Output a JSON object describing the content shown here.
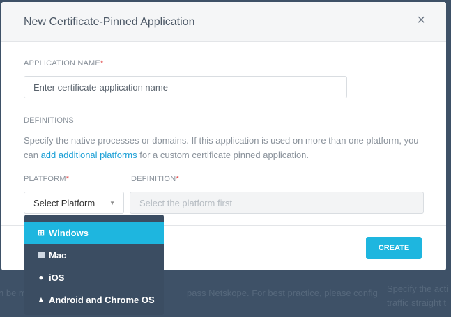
{
  "background": {
    "text_left": "n be m",
    "text_mid": "pass Netskope. For best practice, please config",
    "text_right_1": "Specify the acti",
    "text_right_2": "traffic straight t"
  },
  "modal": {
    "title": "New Certificate-Pinned Application",
    "close_icon": "×",
    "app_name_label": "APPLICATION NAME",
    "required_mark": "*",
    "app_name_placeholder": "Enter certificate-application name",
    "definitions_label": "DEFINITIONS",
    "desc_before": "Specify the native processes or domains. If this application is used on more than one platform, you can ",
    "desc_link": "add additional platforms",
    "desc_after": " for a custom certificate pinned application.",
    "platform_label": "PLATFORM",
    "definition_label": "DEFINITION",
    "platform_value": "Select Platform",
    "definition_placeholder": "Select the platform first",
    "create_label": "CREATE"
  },
  "dropdown": {
    "options": [
      {
        "label": "Windows",
        "icon": "windows-icon",
        "selected": true
      },
      {
        "label": "Mac",
        "icon": "mac-finder-icon"
      },
      {
        "label": "iOS",
        "icon": "apple-icon"
      },
      {
        "label": "Android and Chrome OS",
        "icon": "android-icon"
      }
    ]
  },
  "colors": {
    "accent": "#1eb6df",
    "link": "#1a9fd6",
    "backdrop": "#3e5167",
    "dropdown": "#3b4d62"
  }
}
